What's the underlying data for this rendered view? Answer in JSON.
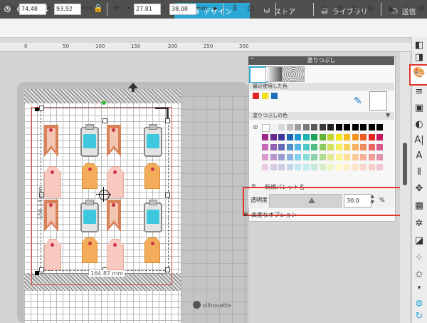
{
  "tabs": [
    {
      "label": "デザイン",
      "icon": "grid-icon"
    },
    {
      "label": "ストア",
      "icon": "store-icon"
    },
    {
      "label": "ライブラリ",
      "icon": "library-icon"
    },
    {
      "label": "送信",
      "icon": "printer-icon"
    }
  ],
  "propbar": {
    "w_label": "W",
    "w_value": "74.48",
    "h_label": "H",
    "h_value": "93.92",
    "unit": "mm",
    "x_label": "X",
    "x_value": "27.81",
    "y_label": "Y",
    "y_value": "38.08"
  },
  "ruler": [
    "0",
    "50",
    "100",
    "150",
    "200",
    "250",
    "300"
  ],
  "canvas": {
    "dim_height": "156.14 mm",
    "dim_width": "164.87 mm",
    "brand": "silhouette"
  },
  "panel": {
    "title": "塗りつぶし",
    "recent_label": "最近使用した色",
    "fill_label": "塗りつぶしの色",
    "recent_colors": [
      "#e52420",
      "#f3e21a",
      "#1f6db6"
    ],
    "new_palette": "新規パレット名",
    "transparency_label": "透明度",
    "transparency_value": "30.0",
    "transparency_unit": "%",
    "advanced": "高度なオプション"
  },
  "accent": "#2aa7d4",
  "highlight_color": "#e0362d"
}
